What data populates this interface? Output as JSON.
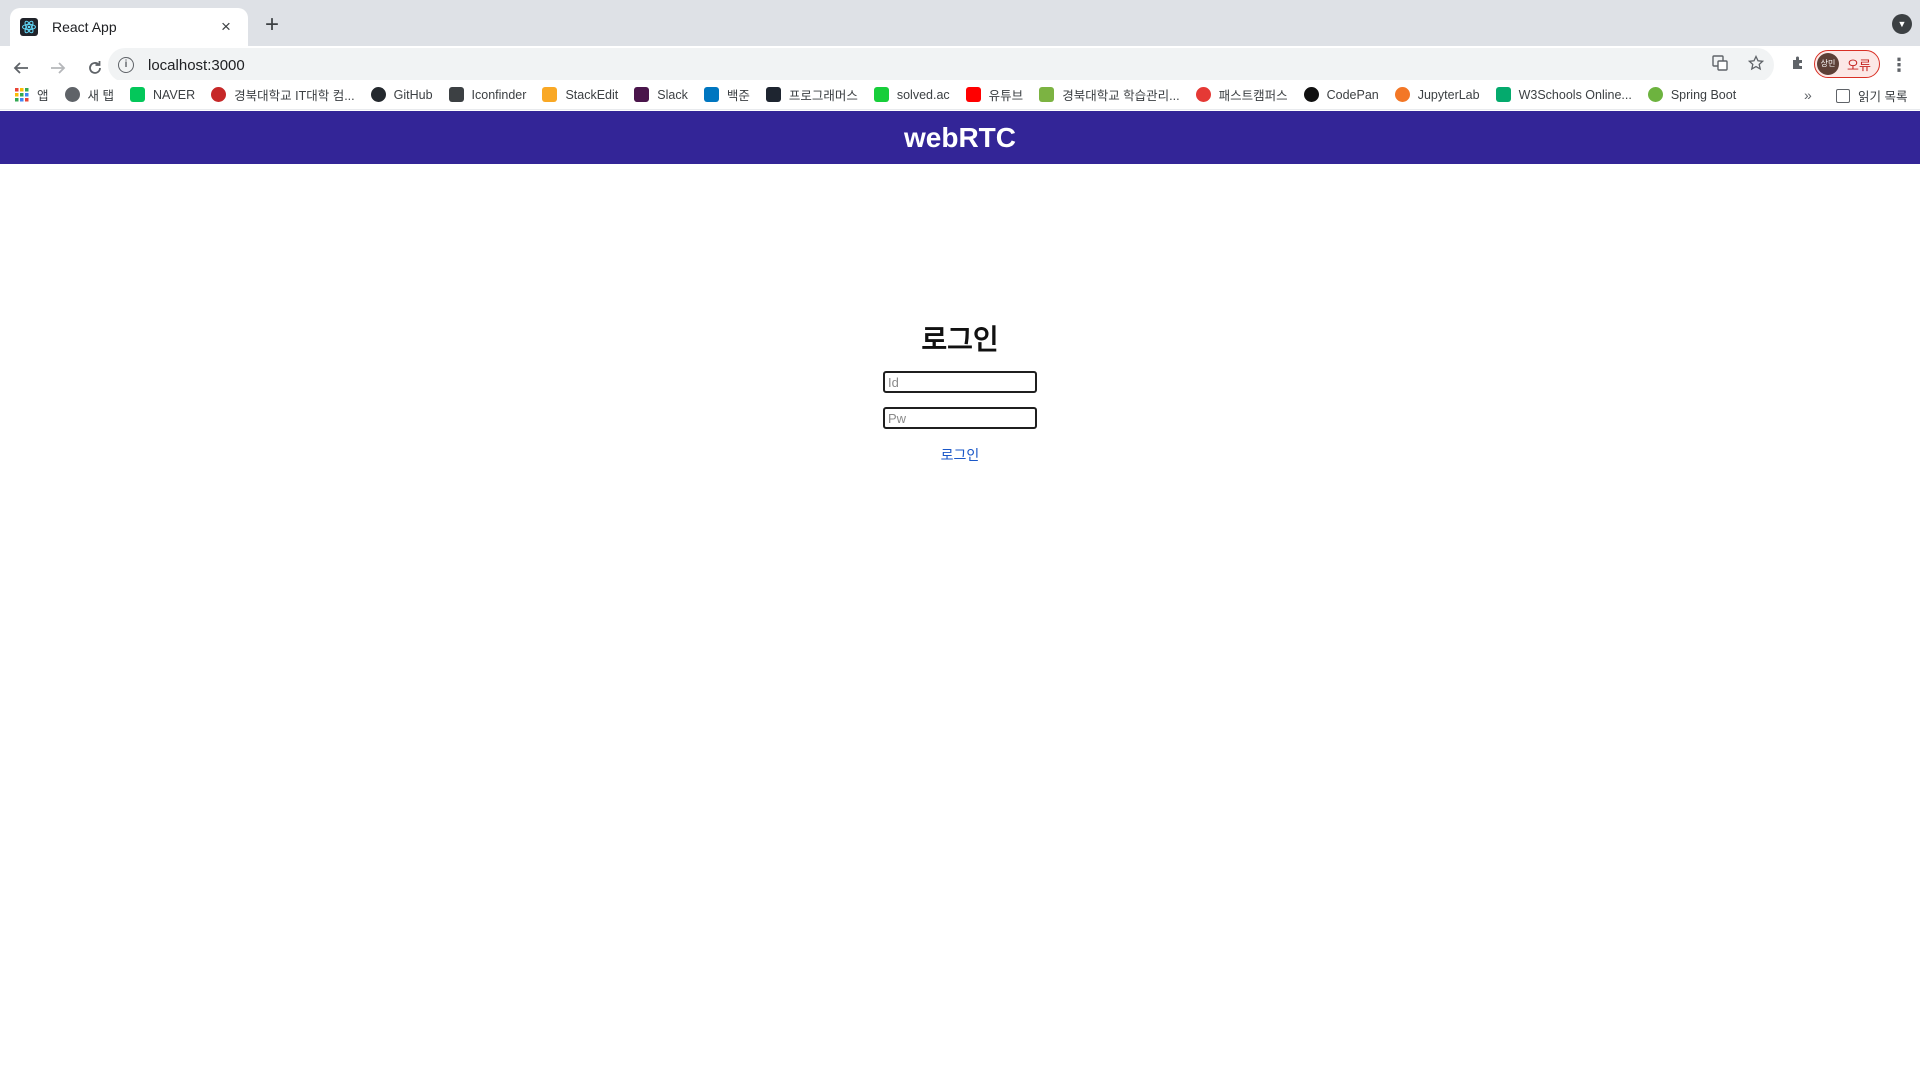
{
  "browser": {
    "tab_title": "React App",
    "tab_close": "×",
    "new_tab": "+",
    "address": "localhost:3000",
    "profile_status": "오류",
    "profile_avatar": "상민",
    "bookmarks_more": "»",
    "reading_list": "읽기 목록"
  },
  "bookmarks": [
    {
      "label": "앱",
      "icon": "apps-grid-icon",
      "color": "#ea4335"
    },
    {
      "label": "새 탭",
      "icon": "globe-icon",
      "color": "#5f6368"
    },
    {
      "label": "NAVER",
      "icon": "naver-icon",
      "color": "#03c75a"
    },
    {
      "label": "경북대학교 IT대학 컴...",
      "icon": "knu-icon",
      "color": "#c62828"
    },
    {
      "label": "GitHub",
      "icon": "github-icon",
      "color": "#24292e"
    },
    {
      "label": "Iconfinder",
      "icon": "iconfinder-icon",
      "color": "#3c4043"
    },
    {
      "label": "StackEdit",
      "icon": "stackedit-icon",
      "color": "#f9a825"
    },
    {
      "label": "Slack",
      "icon": "slack-icon",
      "color": "#4a154b"
    },
    {
      "label": "백준",
      "icon": "code-icon",
      "color": "#0076c0"
    },
    {
      "label": "프로그래머스",
      "icon": "programmers-icon",
      "color": "#1e2530"
    },
    {
      "label": "solved.ac",
      "icon": "solvedac-icon",
      "color": "#17ce3a"
    },
    {
      "label": "유튜브",
      "icon": "youtube-icon",
      "color": "#ff0000"
    },
    {
      "label": "경북대학교 학습관리...",
      "icon": "knu-lms-icon",
      "color": "#7cb342"
    },
    {
      "label": "패스트캠퍼스",
      "icon": "fastcampus-icon",
      "color": "#e53935"
    },
    {
      "label": "CodePan",
      "icon": "codepen-icon",
      "color": "#111111"
    },
    {
      "label": "JupyterLab",
      "icon": "jupyter-icon",
      "color": "#f37726"
    },
    {
      "label": "W3Schools Online...",
      "icon": "w3schools-icon",
      "color": "#04aa6d"
    },
    {
      "label": "Spring Boot",
      "icon": "spring-icon",
      "color": "#6db33f"
    }
  ],
  "app": {
    "title": "webRTC"
  },
  "login": {
    "title": "로그인",
    "id_placeholder": "Id",
    "pw_placeholder": "Pw",
    "submit_label": "로그인"
  }
}
